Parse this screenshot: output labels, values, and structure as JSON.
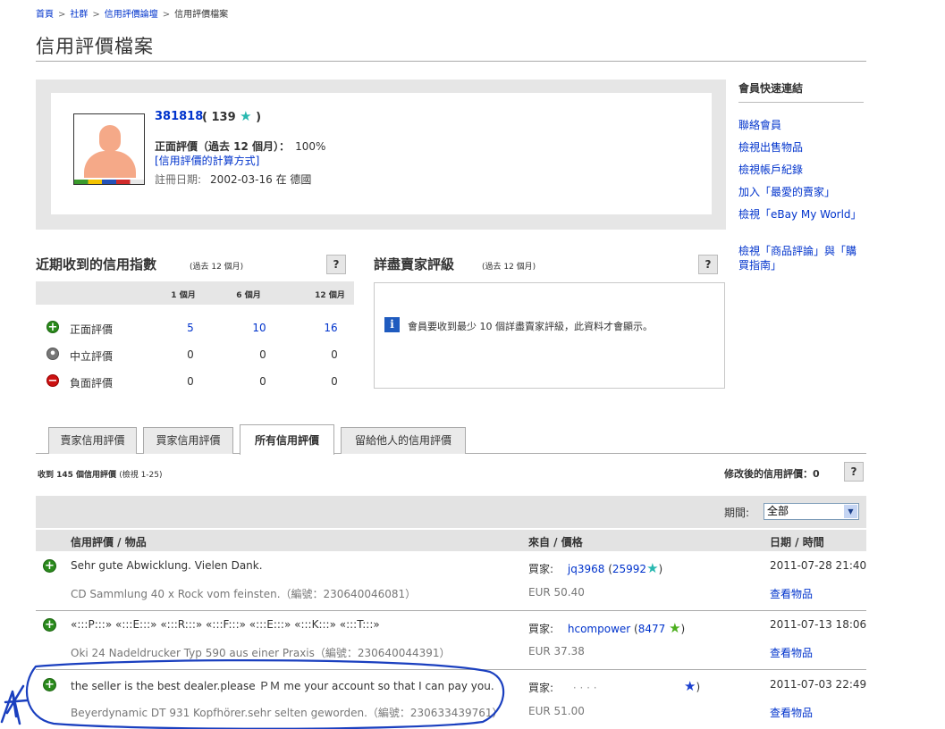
{
  "breadcrumb": [
    "首頁",
    "社群",
    "信用評價論壇",
    "信用評價檔案"
  ],
  "page_title": "信用評價檔案",
  "profile": {
    "username": "381818",
    "score_open": "(",
    "score": "139",
    "score_close": ")",
    "positive_label": "正面評價（過去 12 個月）：",
    "positive_value": "100%",
    "calc_link": "[信用評價的計算方式]",
    "registered_label": "註冊日期:",
    "registered_value": "2002-03-16 在 德國"
  },
  "quick_links": {
    "title": "會員快速連結",
    "items": [
      "聯絡會員",
      "檢視出售物品",
      "檢視帳戶紀錄",
      "加入「最愛的賣家」",
      "檢視「eBay My World」",
      "檢視「商品評論」與「購買指南」"
    ]
  },
  "recent_ratings": {
    "title": "近期收到的信用指數",
    "subtitle": "(過去 12 個月)",
    "help": "?",
    "columns": [
      "1 個月",
      "6 個月",
      "12 個月"
    ],
    "rows": [
      {
        "label": "正面評價",
        "values": [
          "5",
          "10",
          "16"
        ]
      },
      {
        "label": "中立評價",
        "values": [
          "0",
          "0",
          "0"
        ]
      },
      {
        "label": "負面評價",
        "values": [
          "0",
          "0",
          "0"
        ]
      }
    ]
  },
  "detailed_ratings": {
    "title": "詳盡賣家評級",
    "subtitle": "(過去 12 個月)",
    "help": "?",
    "info_icon": "i",
    "message": "會員要收到最少 10 個詳盡賣家評級，此資料才會顯示。"
  },
  "tabs": [
    "賣家信用評價",
    "買家信用評價",
    "所有信用評價",
    "留給他人的信用評價"
  ],
  "active_tab": "所有信用評價",
  "summary": {
    "text": "收到 145 個信用評價",
    "range": "(檢視 1-25)",
    "revised_label": "修改後的信用評價：",
    "revised_value": "0",
    "help": "?"
  },
  "filter": {
    "period_label": "期間:",
    "period_value": "全部"
  },
  "table": {
    "headers": [
      "信用評價 / 物品",
      "來自 / 價格",
      "日期 / 時間"
    ],
    "rows": [
      {
        "comment": "Sehr gute Abwicklung. Vielen Dank.",
        "item": "CD Sammlung 40 x Rock vom feinsten.（編號：230640046081）",
        "role": "買家:",
        "user": "jq3968",
        "user_score": "25992",
        "price": "EUR 50.40",
        "date": "2011-07-28 21:40",
        "view": "查看物品",
        "star_color": "#29b8b0"
      },
      {
        "comment": "«:::P:::» «:::E:::» «:::R:::» «:::F:::» «:::E:::» «:::K:::» «:::T:::»",
        "item": "Oki 24 Nadeldrucker Typ 590 aus einer Praxis（編號：230640044391）",
        "role": "買家:",
        "user": "hcompower",
        "user_score": "8477",
        "price": "EUR 37.38",
        "date": "2011-07-13 18:06",
        "view": "查看物品",
        "star_color": "#4caf1e"
      },
      {
        "comment": "the seller is the best dealer.please ＰＭ me your account so that I can pay you.",
        "item": "Beyerdynamic DT 931 Kopfhörer.sehr selten geworden.（編號：230633439761）",
        "role": "買家:",
        "user": "· · · ·",
        "user_score": "",
        "price": "EUR 51.00",
        "date": "2011-07-03 22:49",
        "view": "查看物品",
        "star_color": "#1b3fcf"
      }
    ]
  },
  "colors": {
    "link": "#0033cc",
    "annotation": "#1a3fbf",
    "positive_icon": "#2a8a1c",
    "negative_icon": "#cc1111"
  }
}
